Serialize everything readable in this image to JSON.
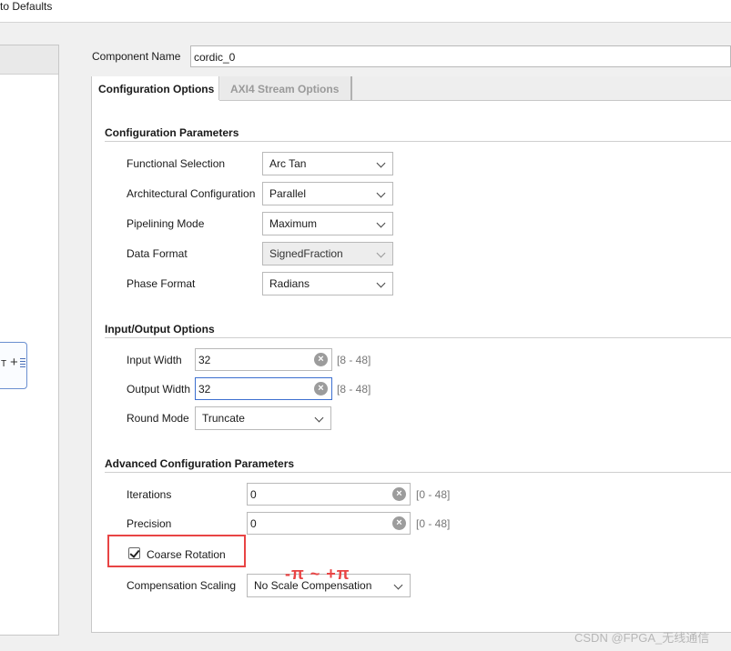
{
  "toolbar": {
    "restore_defaults": "to Defaults"
  },
  "component": {
    "label": "Component Name",
    "value": "cordic_0"
  },
  "tabs": [
    {
      "label": "Configuration Options",
      "active": true
    },
    {
      "label": "AXI4 Stream Options",
      "active": false
    }
  ],
  "symbol": {
    "port_label": "T"
  },
  "config": {
    "title": "Configuration Parameters",
    "rows": [
      {
        "label": "Functional Selection",
        "value": "Arc Tan",
        "disabled": false
      },
      {
        "label": "Architectural Configuration",
        "value": "Parallel",
        "disabled": false
      },
      {
        "label": "Pipelining Mode",
        "value": "Maximum",
        "disabled": false
      },
      {
        "label": "Data Format",
        "value": "SignedFraction",
        "disabled": true
      },
      {
        "label": "Phase Format",
        "value": "Radians",
        "disabled": false
      }
    ]
  },
  "io": {
    "title": "Input/Output Options",
    "input_width": {
      "label": "Input Width",
      "value": "32",
      "range": "[8 - 48]"
    },
    "output_width": {
      "label": "Output Width",
      "value": "32",
      "range": "[8 - 48]"
    },
    "round_mode": {
      "label": "Round Mode",
      "value": "Truncate"
    }
  },
  "advanced": {
    "title": "Advanced Configuration Parameters",
    "iterations": {
      "label": "Iterations",
      "value": "0",
      "range": "[0 - 48]"
    },
    "precision": {
      "label": "Precision",
      "value": "0",
      "range": "[0 - 48]"
    },
    "coarse_rotation": {
      "label": "Coarse Rotation",
      "checked": true
    },
    "compensation": {
      "label": "Compensation Scaling",
      "value": "No Scale Compensation"
    }
  },
  "annotation": "-π ~ +π",
  "watermark": "CSDN @FPGA_无线通信",
  "colors": {
    "highlight": "#e84444",
    "focus": "#3c6fd0"
  }
}
